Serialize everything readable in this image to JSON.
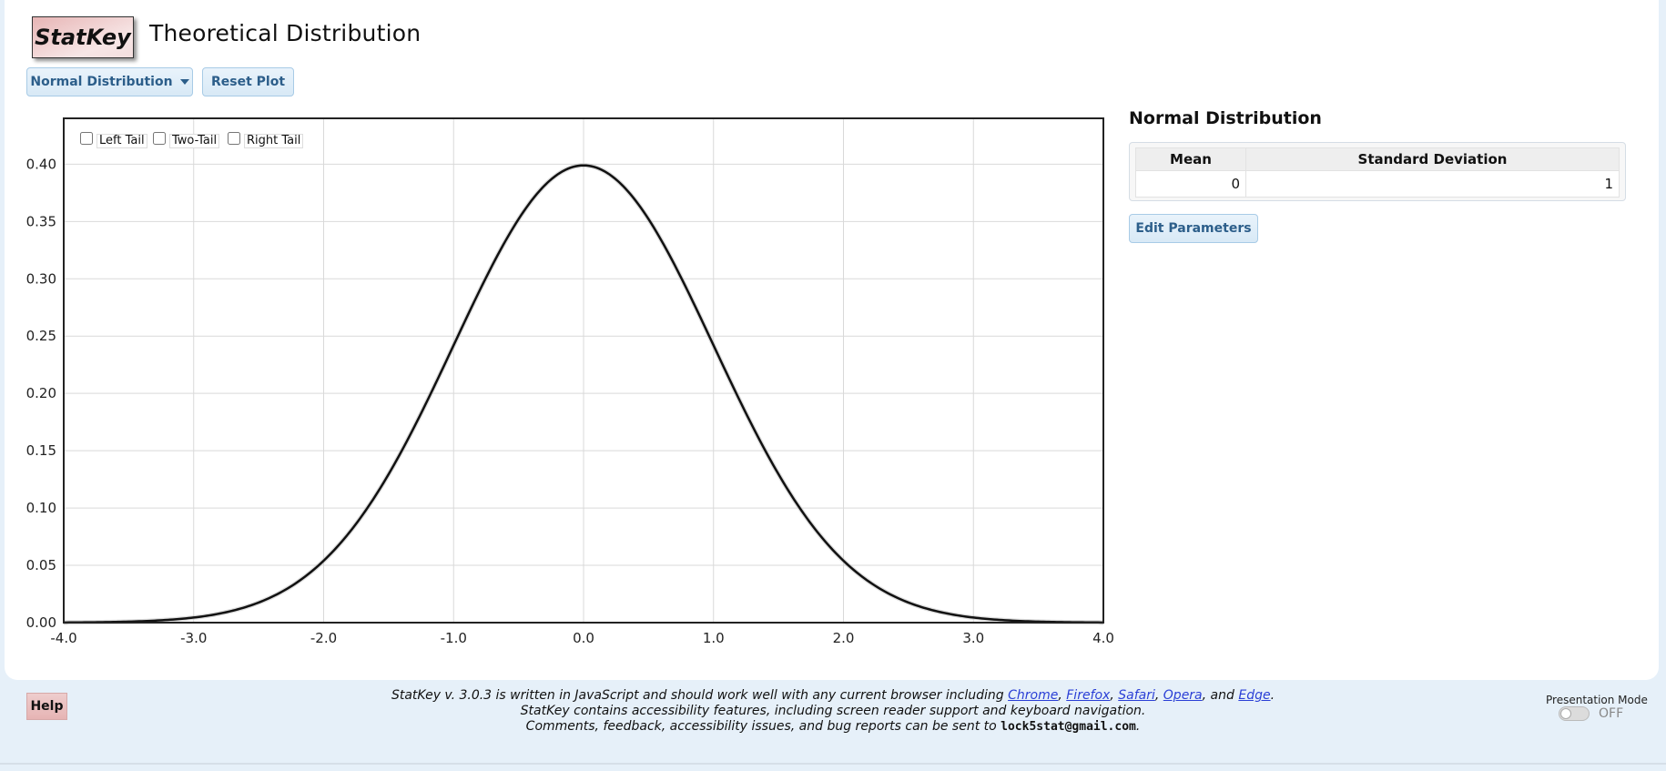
{
  "app": {
    "logo_text": "StatKey",
    "page_title": "Theoretical Distribution"
  },
  "toolbar": {
    "distribution_label": "Normal Distribution",
    "reset_label": "Reset Plot"
  },
  "tails": {
    "left": "Left Tail",
    "two": "Two-Tail",
    "right": "Right Tail"
  },
  "params": {
    "title": "Normal Distribution",
    "headers": [
      "Mean",
      "Standard Deviation"
    ],
    "values": [
      "0",
      "1"
    ],
    "edit_label": "Edit Parameters"
  },
  "chart_data": {
    "type": "line",
    "distribution": "normal",
    "mean": 0,
    "sd": 1,
    "xlim": [
      -4.0,
      4.0
    ],
    "ylim": [
      0,
      0.44
    ],
    "x_ticks": [
      "-4.0",
      "-3.0",
      "-2.0",
      "-1.0",
      "0.0",
      "1.0",
      "2.0",
      "3.0",
      "4.0"
    ],
    "y_ticks": [
      "0.00",
      "0.05",
      "0.10",
      "0.15",
      "0.20",
      "0.25",
      "0.30",
      "0.35",
      "0.40"
    ],
    "grid": true,
    "line_color": "#111111"
  },
  "footer": {
    "line1_prefix": "StatKey v. 3.0.3 is written in JavaScript and should work well with any current browser including ",
    "browsers": [
      "Chrome",
      "Firefox",
      "Safari",
      "Opera",
      "Edge"
    ],
    "sep1": ", ",
    "sep_and": ", and ",
    "line1_suffix": ".",
    "line2": "StatKey contains accessibility features, including screen reader support and keyboard navigation.",
    "line3_prefix": "Comments, feedback, accessibility issues, and bug reports can be sent to ",
    "email": "lock5stat@gmail.com",
    "line3_suffix": ".",
    "help_label": "Help",
    "presentation_label": "Presentation Mode",
    "presentation_state": "OFF"
  }
}
